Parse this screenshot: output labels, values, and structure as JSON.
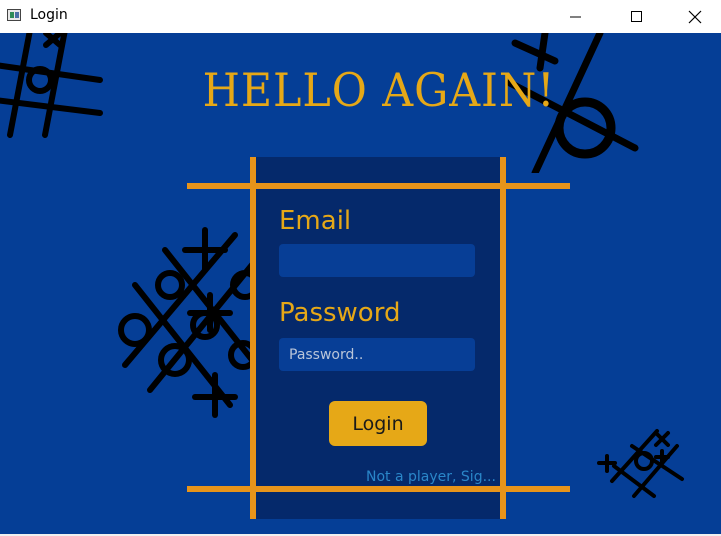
{
  "window": {
    "title": "Login",
    "app_icon": "window-app-icon",
    "controls": [
      "minimize-icon",
      "maximize-icon",
      "close-icon"
    ]
  },
  "screen": {
    "heading": "HELLO AGAIN!",
    "email_label": "Email",
    "email_value": "",
    "email_placeholder": "",
    "password_label": "Password",
    "password_value": "",
    "password_placeholder": "Password..",
    "login_label": "Login",
    "signup_link": "Not a player, Sig..."
  },
  "colors": {
    "background": "#053e96",
    "panel": "#05296b",
    "accent": "#e6a817",
    "grid": "#e8941a",
    "link": "#2a86c9"
  }
}
